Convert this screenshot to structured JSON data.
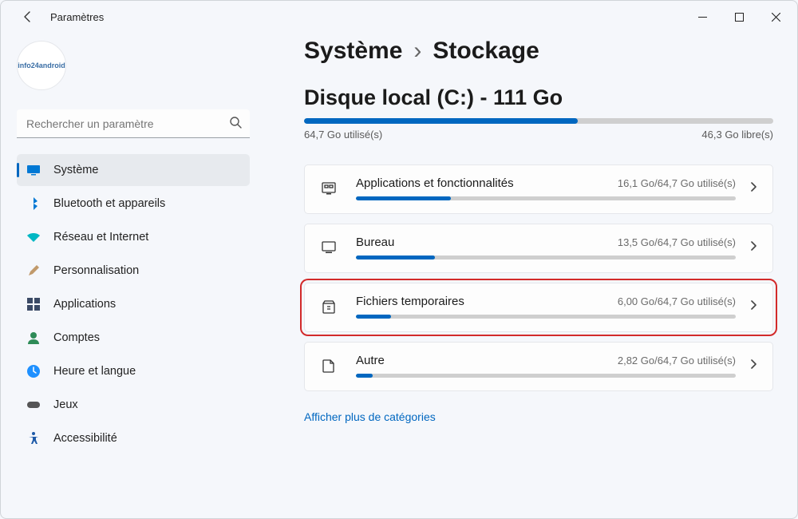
{
  "window": {
    "title": "Paramètres"
  },
  "search": {
    "placeholder": "Rechercher un paramètre"
  },
  "profile": {
    "logo_text": "info24android"
  },
  "sidebar": {
    "items": [
      {
        "label": "Système"
      },
      {
        "label": "Bluetooth et appareils"
      },
      {
        "label": "Réseau et Internet"
      },
      {
        "label": "Personnalisation"
      },
      {
        "label": "Applications"
      },
      {
        "label": "Comptes"
      },
      {
        "label": "Heure et langue"
      },
      {
        "label": "Jeux"
      },
      {
        "label": "Accessibilité"
      }
    ]
  },
  "breadcrumb": {
    "parent": "Système",
    "current": "Stockage"
  },
  "disk": {
    "label": "Disque local (C:) - 111 Go",
    "used_text": "64,7 Go utilisé(s)",
    "free_text": "46,3 Go libre(s)",
    "used_pct": 58.3
  },
  "categories": [
    {
      "name": "Applications et fonctionnalités",
      "usage": "16,1 Go/64,7 Go utilisé(s)",
      "pct": 24.9
    },
    {
      "name": "Bureau",
      "usage": "13,5 Go/64,7 Go utilisé(s)",
      "pct": 20.9
    },
    {
      "name": "Fichiers temporaires",
      "usage": "6,00 Go/64,7 Go utilisé(s)",
      "pct": 9.3,
      "highlight": true
    },
    {
      "name": "Autre",
      "usage": "2,82 Go/64,7 Go utilisé(s)",
      "pct": 4.4
    }
  ],
  "more_link": "Afficher plus de catégories",
  "colors": {
    "accent": "#0067c0",
    "highlight_border": "#d22a2a"
  }
}
